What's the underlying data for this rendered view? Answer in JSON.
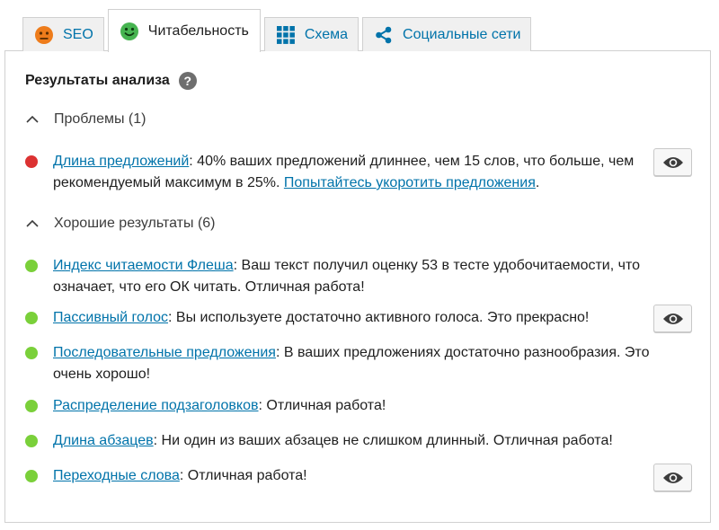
{
  "tabs": [
    {
      "label": "SEO",
      "icon": "sad-face-icon",
      "color": "#ee7c1b"
    },
    {
      "label": "Читабельность",
      "icon": "smile-face-icon",
      "color": "#46b450"
    },
    {
      "label": "Схема",
      "icon": "grid-icon",
      "color": "#0073aa"
    },
    {
      "label": "Социальные сети",
      "icon": "share-icon",
      "color": "#0073aa"
    }
  ],
  "panel": {
    "title": "Результаты анализа",
    "help": "?",
    "problems": {
      "heading": "Проблемы (1)",
      "items": [
        {
          "link": "Длина предложений",
          "text": ": 40% ваших предложений длиннее, чем 15 слов, что больше, чем рекомендуемый максимум в 25%. ",
          "link2": "Попытайтесь укоротить предложения",
          "tail": "."
        }
      ]
    },
    "good": {
      "heading": "Хорошие результаты (6)",
      "items": [
        {
          "link": "Индекс читаемости Флеша",
          "text": ": Ваш текст получил оценку 53 в тесте удобочитаемости, что означает, что его ОК читать. Отличная работа!"
        },
        {
          "link": "Пассивный голос",
          "text": ": Вы используете достаточно активного голоса. Это прекрасно!"
        },
        {
          "link": "Последовательные предложения",
          "text": ": В ваших предложениях достаточно разнообразия. Это очень хорошо!"
        },
        {
          "link": "Распределение подзаголовков",
          "text": ": Отличная работа!"
        },
        {
          "link": "Длина абзацев",
          "text": ": Ни один из ваших абзацев не слишком длинный. Отличная работа!"
        },
        {
          "link": "Переходные слова",
          "text": ": Отличная работа!"
        }
      ]
    }
  },
  "colors": {
    "link": "#0073aa",
    "bad": "#dc3232",
    "good": "#7ad03a"
  }
}
